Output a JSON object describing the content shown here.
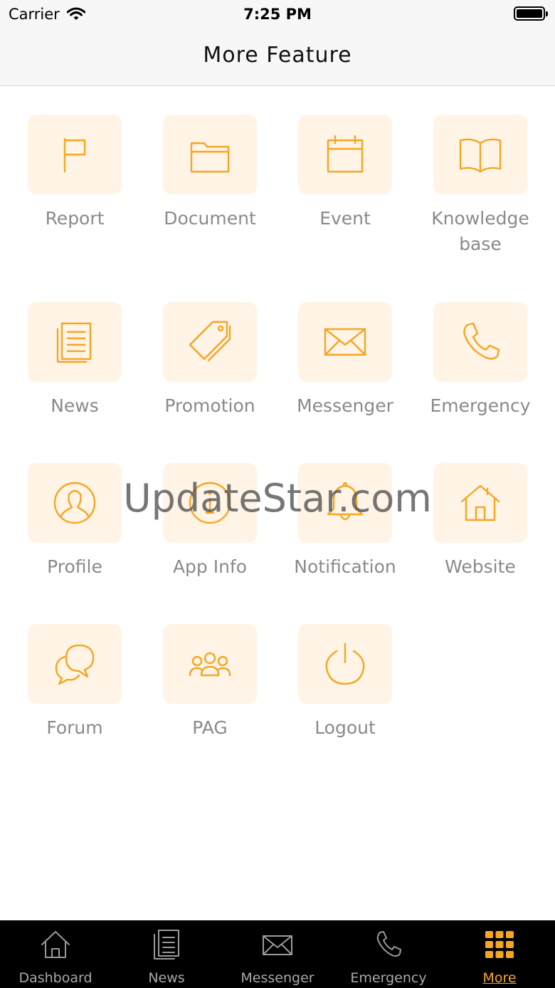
{
  "status_bar": {
    "carrier": "Carrier",
    "time": "7:25 PM"
  },
  "header": {
    "title": "More Feature"
  },
  "accent_color": "#f5a623",
  "tile_background": "#fff4e6",
  "features": [
    {
      "label": "Report",
      "icon": "flag-icon"
    },
    {
      "label": "Document",
      "icon": "folder-icon"
    },
    {
      "label": "Event",
      "icon": "calendar-icon"
    },
    {
      "label": "Knowledge\nbase",
      "icon": "book-icon"
    },
    {
      "label": "News",
      "icon": "newspaper-icon"
    },
    {
      "label": "Promotion",
      "icon": "tag-icon"
    },
    {
      "label": "Messenger",
      "icon": "envelope-icon"
    },
    {
      "label": "Emergency",
      "icon": "phone-icon"
    },
    {
      "label": "Profile",
      "icon": "user-circle-icon"
    },
    {
      "label": "App Info",
      "icon": "info-circle-icon"
    },
    {
      "label": "Notification",
      "icon": "bell-icon"
    },
    {
      "label": "Website",
      "icon": "home-icon"
    },
    {
      "label": "Forum",
      "icon": "chat-bubbles-icon"
    },
    {
      "label": "PAG",
      "icon": "group-icon"
    },
    {
      "label": "Logout",
      "icon": "power-icon"
    }
  ],
  "watermark": "UpdateStar.com",
  "tabs": [
    {
      "label": "Dashboard",
      "icon": "home-icon"
    },
    {
      "label": "News",
      "icon": "newspaper-icon"
    },
    {
      "label": "Messenger",
      "icon": "envelope-icon"
    },
    {
      "label": "Emergency",
      "icon": "phone-icon"
    },
    {
      "label": "More",
      "icon": "grid-icon",
      "active": true
    }
  ]
}
